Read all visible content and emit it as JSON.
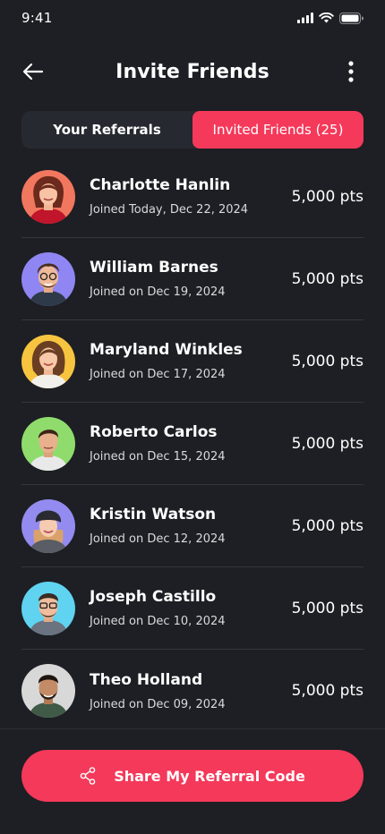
{
  "status_bar": {
    "time": "9:41"
  },
  "header": {
    "title": "Invite Friends"
  },
  "tabs": [
    {
      "label": "Your Referrals",
      "active": false
    },
    {
      "label": "Invited Friends (25)",
      "active": true
    }
  ],
  "friends": [
    {
      "name": "Charlotte Hanlin",
      "joined": "Joined Today, Dec 22, 2024",
      "points": "5,000 pts",
      "avatar_bg": "#f2775f"
    },
    {
      "name": "William Barnes",
      "joined": "Joined on Dec 19, 2024",
      "points": "5,000 pts",
      "avatar_bg": "#8f86f3"
    },
    {
      "name": "Maryland Winkles",
      "joined": "Joined on Dec 17, 2024",
      "points": "5,000 pts",
      "avatar_bg": "#f7c440"
    },
    {
      "name": "Roberto Carlos",
      "joined": "Joined on Dec 15, 2024",
      "points": "5,000 pts",
      "avatar_bg": "#8fdc6d"
    },
    {
      "name": "Kristin Watson",
      "joined": "Joined on Dec 12, 2024",
      "points": "5,000 pts",
      "avatar_bg": "#948bf0"
    },
    {
      "name": "Joseph Castillo",
      "joined": "Joined on Dec 10, 2024",
      "points": "5,000 pts",
      "avatar_bg": "#5fd3ef"
    },
    {
      "name": "Theo Holland",
      "joined": "Joined on Dec 09, 2024",
      "points": "5,000 pts",
      "avatar_bg": "#d8d8d8"
    }
  ],
  "share_button": {
    "label": "Share My Referral Code",
    "icon": "share-icon"
  },
  "colors": {
    "accent": "#f4395a",
    "background": "#1d1f24",
    "tab_bg": "#262930"
  }
}
